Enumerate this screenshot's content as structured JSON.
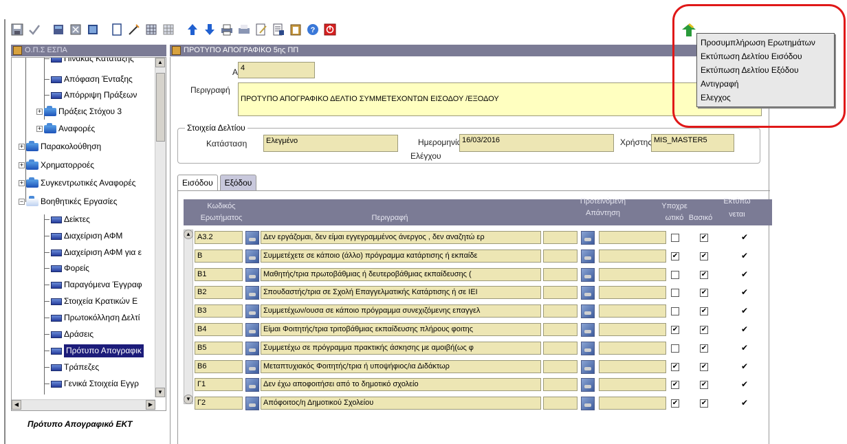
{
  "toolbar": {
    "buttons": [
      "save-icon",
      "commit-icon",
      "db-icon",
      "grid-icon",
      "table-icon",
      "blank-icon",
      "edit-icon",
      "grid-add-icon",
      "grid-remove-icon",
      "arrow-up-icon",
      "arrow-down-icon",
      "print-icon",
      "print-preview-icon",
      "edit-document-icon",
      "report-icon",
      "clipboard-icon",
      "help-icon",
      "exit-icon"
    ]
  },
  "left_panel": {
    "title": "Ο.Π.Σ ΕΣΠΑ",
    "items": [
      {
        "label": "Πίνακας Κατάταξης"
      },
      {
        "label": "Απόφαση Ένταξης"
      },
      {
        "label": "Απόρριψη Πράξεων"
      },
      {
        "label": "Πράξεις Στόχου 3"
      },
      {
        "label": "Αναφορές"
      },
      {
        "label": "Παρακολούθηση"
      },
      {
        "label": "Χρηματορροές"
      },
      {
        "label": "Συγκεντρωτικές Αναφορές"
      },
      {
        "label": "Βοηθητικές Εργασίες"
      },
      {
        "label": "Δείκτες"
      },
      {
        "label": "Διαχείριση ΑΦΜ"
      },
      {
        "label": "Διαχείριση ΑΦΜ για ε"
      },
      {
        "label": "Φορείς"
      },
      {
        "label": "Παραγόμενα Έγγραφ"
      },
      {
        "label": "Στοιχεία Κρατικών Ε"
      },
      {
        "label": "Πρωτοκόλληση Δελτί"
      },
      {
        "label": "Δράσεις"
      },
      {
        "label": "Πρότυπο Απογραφικ"
      },
      {
        "label": "Τράπεζες"
      },
      {
        "label": "Γενικά Στοιχεία Εγγρ"
      }
    ],
    "footer": "Πρότυπο Απογραφικό ΕΚΤ"
  },
  "form": {
    "title": "ΠΡΟΤΥΠΟ ΑΠΟΓΡΑΦΙΚΟ 5ης ΠΠ",
    "aa_label": "ΑΑ",
    "aa_value": "4",
    "desc_label": "Περιγραφή",
    "desc_value": "ΠΡΟΤΥΠΟ ΑΠΟΓΡΑΦΙΚΟ ΔΕΛΤΙΟ ΣΥΜΜΕΤΕΧΟΝΤΩΝ  ΕΙΣΟΔΟΥ /ΕΞΟΔΟΥ",
    "group_title": "Στοιχεία Δελτίου",
    "status_label": "Κατάσταση",
    "status_value": "Ελεγμένο",
    "date_label_1": "Ημερομηνία",
    "date_label_2": "Ελέγχου",
    "date_value": "16/03/2016",
    "user_label": "Χρήστης",
    "user_value": "MIS_MASTER5",
    "tabs": [
      "Εισόδου",
      "Εξόδου"
    ],
    "grid": {
      "col_code_1": "Κωδικός",
      "col_code_2": "Ερωτήματος",
      "col_desc": "Περιγραφή",
      "col_prop_1": "Προτεινόμενη",
      "col_prop_2": "Απάντηση",
      "col_req_1": "Υποχρε",
      "col_req_2": "ωτικό",
      "col_basic": "Βασικό",
      "col_print_1": "Εκτύπω",
      "col_print_2": "νεται",
      "rows": [
        {
          "code": "Α3.2",
          "desc": "Δεν εργάζομαι, δεν είμαι εγγεγραμμένος άνεργος , δεν αναζητώ ερ",
          "req": "",
          "basic": "✔",
          "print": "✔"
        },
        {
          "code": "Β",
          "desc": "Συμμετέχετε σε κάποιο (άλλο) πρόγραμμα κατάρτισης ή εκπαίδε",
          "req": "✔",
          "basic": "✔",
          "print": "✔"
        },
        {
          "code": "Β1",
          "desc": "Μαθητής/τρια πρωτοβάθμιας ή δευτεροβάθμιας εκπαίδευσης (",
          "req": "",
          "basic": "✔",
          "print": "✔"
        },
        {
          "code": "Β2",
          "desc": "Σπουδαστής/τρια σε Σχολή Επαγγελματικής Κατάρτισης ή σε ΙΕΙ",
          "req": "",
          "basic": "✔",
          "print": "✔"
        },
        {
          "code": "Β3",
          "desc": "Συμμετέχων/ουσα σε κάποιο πρόγραμμα συνεχιζόμενης επαγγελ",
          "req": "",
          "basic": "✔",
          "print": "✔"
        },
        {
          "code": "Β4",
          "desc": "Είμαι Φοιτητής/τρια τριτοβάθμιας εκπαίδευσης πλήρους φοιτης",
          "req": "✔",
          "basic": "✔",
          "print": "✔"
        },
        {
          "code": "Β5",
          "desc": "Συμμετέχω σε πρόγραμμα πρακτικής  άσκησης με αμοιβή(ως φ",
          "req": "",
          "basic": "✔",
          "print": "✔"
        },
        {
          "code": "Β6",
          "desc": "Μεταπτυχιακός Φοιτητής/τρια ή   υποψήφιος/ια  Διδάκτωρ",
          "req": "✔",
          "basic": "✔",
          "print": "✔"
        },
        {
          "code": "Γ1",
          "desc": "Δεν έχω αποφοιτήσει από το δημοτικό σχολείο",
          "req": "✔",
          "basic": "✔",
          "print": "✔"
        },
        {
          "code": "Γ2",
          "desc": "Απόφοιτος/η  Δημοτικού Σχολείου",
          "req": "✔",
          "basic": "✔",
          "print": "✔"
        }
      ]
    }
  },
  "popup_menu": {
    "items": [
      "Προσυμπλήρωση Ερωτημάτων",
      "Εκτύπωση Δελτίου Εισόδου",
      "Εκτύπωση Δελτίου Εξόδου",
      "Αντιγραφή",
      "Ελεγχος"
    ]
  },
  "colors": {
    "header_bg": "#7b7b95",
    "field_bg": "#ede6b4",
    "highlight": "#e01818"
  }
}
